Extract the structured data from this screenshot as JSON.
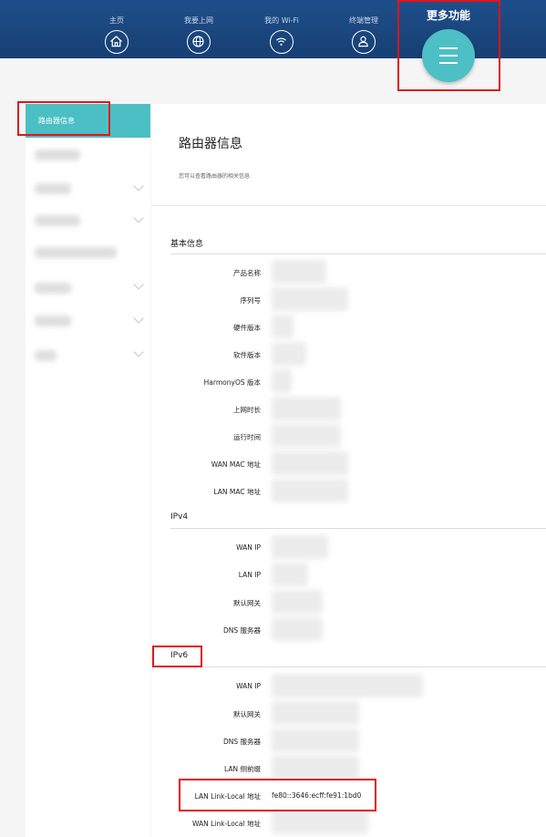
{
  "nav": {
    "home": "主页",
    "internet": "我要上网",
    "wifi": "我的 Wi-Fi",
    "devices": "终端管理",
    "more": "更多功能"
  },
  "sidebar": {
    "active_item": "路由器信息"
  },
  "page": {
    "title": "路由器信息",
    "subtitle": "您可以查看路由器的相关信息"
  },
  "sections": {
    "basic": {
      "title": "基本信息",
      "labels": [
        "产品名称",
        "序列号",
        "硬件版本",
        "软件版本",
        "HarmonyOS 版本",
        "上网时长",
        "运行时间",
        "WAN MAC 地址",
        "LAN MAC 地址"
      ]
    },
    "ipv4": {
      "title": "IPv4",
      "labels": [
        "WAN IP",
        "LAN IP",
        "默认网关",
        "DNS 服务器"
      ]
    },
    "ipv6": {
      "title": "IPv6",
      "labels": [
        "WAN IP",
        "默认网关",
        "DNS 服务器",
        "LAN 侧前缀",
        "LAN Link-Local 地址",
        "WAN Link-Local 地址"
      ],
      "lan_link_local_value": "fe80::3646:ecff:fe91:1bd0"
    }
  }
}
